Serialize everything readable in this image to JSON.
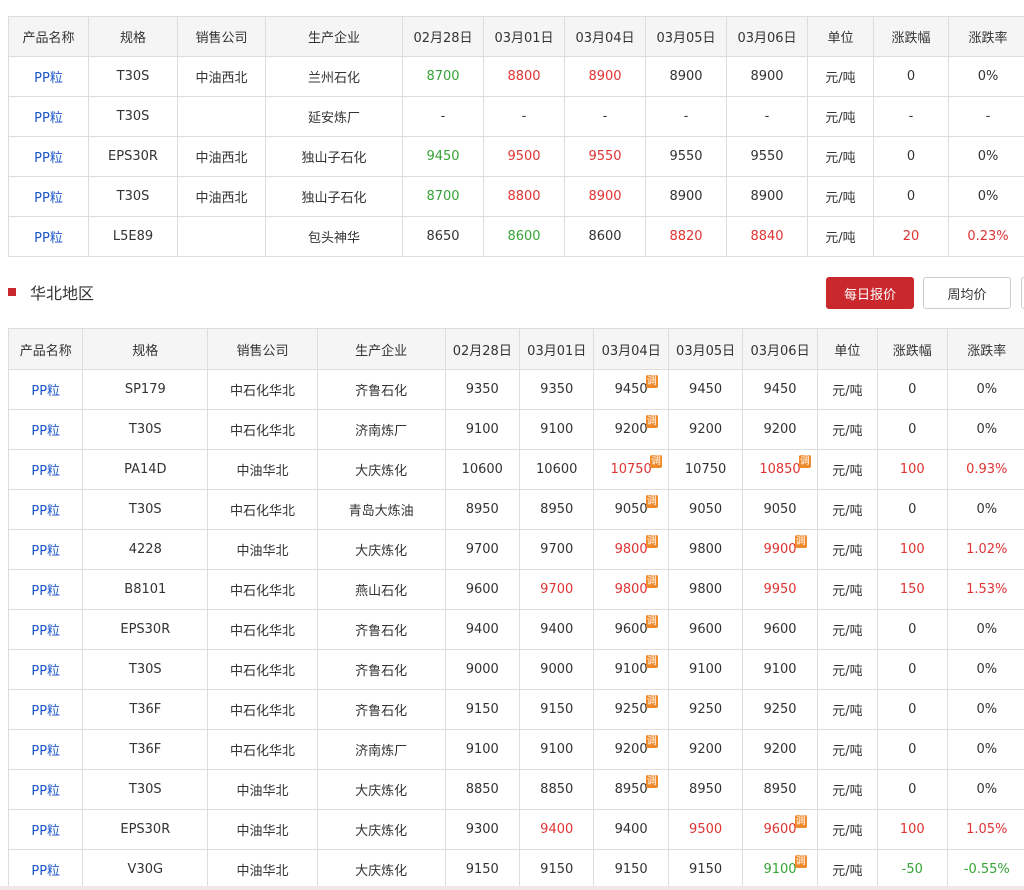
{
  "northwest": {
    "headers": [
      "产品名称",
      "规格",
      "销售公司",
      "生产企业",
      "02月28日",
      "03月01日",
      "03月04日",
      "03月05日",
      "03月06日",
      "单位",
      "涨跌幅",
      "涨跌率"
    ],
    "rows": [
      {
        "product": "PP粒",
        "spec": "T30S",
        "company": "中油西北",
        "producer": "兰州石化",
        "prices": [
          {
            "v": "8700",
            "c": "down"
          },
          {
            "v": "8800",
            "c": "up"
          },
          {
            "v": "8900",
            "c": "up"
          },
          {
            "v": "8900",
            "c": "flat"
          },
          {
            "v": "8900",
            "c": "flat"
          }
        ],
        "unit": "元/吨",
        "change": {
          "v": "0",
          "c": "flat"
        },
        "rate": {
          "v": "0%",
          "c": "flat"
        }
      },
      {
        "product": "PP粒",
        "spec": "T30S",
        "company": "",
        "producer": "延安炼厂",
        "prices": [
          {
            "v": "-",
            "c": "flat"
          },
          {
            "v": "-",
            "c": "flat"
          },
          {
            "v": "-",
            "c": "flat"
          },
          {
            "v": "-",
            "c": "flat"
          },
          {
            "v": "-",
            "c": "flat"
          }
        ],
        "unit": "元/吨",
        "change": {
          "v": "-",
          "c": "flat"
        },
        "rate": {
          "v": "-",
          "c": "flat"
        }
      },
      {
        "product": "PP粒",
        "spec": "EPS30R",
        "company": "中油西北",
        "producer": "独山子石化",
        "prices": [
          {
            "v": "9450",
            "c": "down"
          },
          {
            "v": "9500",
            "c": "up"
          },
          {
            "v": "9550",
            "c": "up"
          },
          {
            "v": "9550",
            "c": "flat"
          },
          {
            "v": "9550",
            "c": "flat"
          }
        ],
        "unit": "元/吨",
        "change": {
          "v": "0",
          "c": "flat"
        },
        "rate": {
          "v": "0%",
          "c": "flat"
        }
      },
      {
        "product": "PP粒",
        "spec": "T30S",
        "company": "中油西北",
        "producer": "独山子石化",
        "prices": [
          {
            "v": "8700",
            "c": "down"
          },
          {
            "v": "8800",
            "c": "up"
          },
          {
            "v": "8900",
            "c": "up"
          },
          {
            "v": "8900",
            "c": "flat"
          },
          {
            "v": "8900",
            "c": "flat"
          }
        ],
        "unit": "元/吨",
        "change": {
          "v": "0",
          "c": "flat"
        },
        "rate": {
          "v": "0%",
          "c": "flat"
        }
      },
      {
        "product": "PP粒",
        "spec": "L5E89",
        "company": "",
        "producer": "包头神华",
        "prices": [
          {
            "v": "8650",
            "c": "flat"
          },
          {
            "v": "8600",
            "c": "down"
          },
          {
            "v": "8600",
            "c": "flat"
          },
          {
            "v": "8820",
            "c": "up"
          },
          {
            "v": "8840",
            "c": "up"
          }
        ],
        "unit": "元/吨",
        "change": {
          "v": "20",
          "c": "up"
        },
        "rate": {
          "v": "0.23%",
          "c": "up"
        }
      }
    ]
  },
  "north_china": {
    "title": "华北地区",
    "buttons": {
      "daily": "每日报价",
      "weekly": "周均价"
    },
    "adjust_mark": "调",
    "headers": [
      "产品名称",
      "规格",
      "销售公司",
      "生产企业",
      "02月28日",
      "03月01日",
      "03月04日",
      "03月05日",
      "03月06日",
      "单位",
      "涨跌幅",
      "涨跌率"
    ],
    "rows": [
      {
        "product": "PP粒",
        "spec": "SP179",
        "company": "中石化华北",
        "producer": "齐鲁石化",
        "prices": [
          {
            "v": "9350",
            "c": "flat"
          },
          {
            "v": "9350",
            "c": "flat"
          },
          {
            "v": "9450",
            "c": "flat",
            "adj": true
          },
          {
            "v": "9450",
            "c": "flat"
          },
          {
            "v": "9450",
            "c": "flat"
          }
        ],
        "unit": "元/吨",
        "change": {
          "v": "0",
          "c": "flat"
        },
        "rate": {
          "v": "0%",
          "c": "flat"
        }
      },
      {
        "product": "PP粒",
        "spec": "T30S",
        "company": "中石化华北",
        "producer": "济南炼厂",
        "prices": [
          {
            "v": "9100",
            "c": "flat"
          },
          {
            "v": "9100",
            "c": "flat"
          },
          {
            "v": "9200",
            "c": "flat",
            "adj": true
          },
          {
            "v": "9200",
            "c": "flat"
          },
          {
            "v": "9200",
            "c": "flat"
          }
        ],
        "unit": "元/吨",
        "change": {
          "v": "0",
          "c": "flat"
        },
        "rate": {
          "v": "0%",
          "c": "flat"
        }
      },
      {
        "product": "PP粒",
        "spec": "PA14D",
        "company": "中油华北",
        "producer": "大庆炼化",
        "prices": [
          {
            "v": "10600",
            "c": "flat"
          },
          {
            "v": "10600",
            "c": "flat"
          },
          {
            "v": "10750",
            "c": "up",
            "adj": true
          },
          {
            "v": "10750",
            "c": "flat"
          },
          {
            "v": "10850",
            "c": "up",
            "adj": true
          }
        ],
        "unit": "元/吨",
        "change": {
          "v": "100",
          "c": "up"
        },
        "rate": {
          "v": "0.93%",
          "c": "up"
        }
      },
      {
        "product": "PP粒",
        "spec": "T30S",
        "company": "中石化华北",
        "producer": "青岛大炼油",
        "prices": [
          {
            "v": "8950",
            "c": "flat"
          },
          {
            "v": "8950",
            "c": "flat"
          },
          {
            "v": "9050",
            "c": "flat",
            "adj": true
          },
          {
            "v": "9050",
            "c": "flat"
          },
          {
            "v": "9050",
            "c": "flat"
          }
        ],
        "unit": "元/吨",
        "change": {
          "v": "0",
          "c": "flat"
        },
        "rate": {
          "v": "0%",
          "c": "flat"
        }
      },
      {
        "product": "PP粒",
        "spec": "4228",
        "company": "中油华北",
        "producer": "大庆炼化",
        "prices": [
          {
            "v": "9700",
            "c": "flat"
          },
          {
            "v": "9700",
            "c": "flat"
          },
          {
            "v": "9800",
            "c": "up",
            "adj": true
          },
          {
            "v": "9800",
            "c": "flat"
          },
          {
            "v": "9900",
            "c": "up",
            "adj": true
          }
        ],
        "unit": "元/吨",
        "change": {
          "v": "100",
          "c": "up"
        },
        "rate": {
          "v": "1.02%",
          "c": "up"
        }
      },
      {
        "product": "PP粒",
        "spec": "B8101",
        "company": "中石化华北",
        "producer": "燕山石化",
        "prices": [
          {
            "v": "9600",
            "c": "flat"
          },
          {
            "v": "9700",
            "c": "up"
          },
          {
            "v": "9800",
            "c": "up",
            "adj": true
          },
          {
            "v": "9800",
            "c": "flat"
          },
          {
            "v": "9950",
            "c": "up"
          }
        ],
        "unit": "元/吨",
        "change": {
          "v": "150",
          "c": "up"
        },
        "rate": {
          "v": "1.53%",
          "c": "up"
        }
      },
      {
        "product": "PP粒",
        "spec": "EPS30R",
        "company": "中石化华北",
        "producer": "齐鲁石化",
        "prices": [
          {
            "v": "9400",
            "c": "flat"
          },
          {
            "v": "9400",
            "c": "flat"
          },
          {
            "v": "9600",
            "c": "flat",
            "adj": true
          },
          {
            "v": "9600",
            "c": "flat"
          },
          {
            "v": "9600",
            "c": "flat"
          }
        ],
        "unit": "元/吨",
        "change": {
          "v": "0",
          "c": "flat"
        },
        "rate": {
          "v": "0%",
          "c": "flat"
        }
      },
      {
        "product": "PP粒",
        "spec": "T30S",
        "company": "中石化华北",
        "producer": "齐鲁石化",
        "prices": [
          {
            "v": "9000",
            "c": "flat"
          },
          {
            "v": "9000",
            "c": "flat"
          },
          {
            "v": "9100",
            "c": "flat",
            "adj": true
          },
          {
            "v": "9100",
            "c": "flat"
          },
          {
            "v": "9100",
            "c": "flat"
          }
        ],
        "unit": "元/吨",
        "change": {
          "v": "0",
          "c": "flat"
        },
        "rate": {
          "v": "0%",
          "c": "flat"
        }
      },
      {
        "product": "PP粒",
        "spec": "T36F",
        "company": "中石化华北",
        "producer": "齐鲁石化",
        "prices": [
          {
            "v": "9150",
            "c": "flat"
          },
          {
            "v": "9150",
            "c": "flat"
          },
          {
            "v": "9250",
            "c": "flat",
            "adj": true
          },
          {
            "v": "9250",
            "c": "flat"
          },
          {
            "v": "9250",
            "c": "flat"
          }
        ],
        "unit": "元/吨",
        "change": {
          "v": "0",
          "c": "flat"
        },
        "rate": {
          "v": "0%",
          "c": "flat"
        }
      },
      {
        "product": "PP粒",
        "spec": "T36F",
        "company": "中石化华北",
        "producer": "济南炼厂",
        "prices": [
          {
            "v": "9100",
            "c": "flat"
          },
          {
            "v": "9100",
            "c": "flat"
          },
          {
            "v": "9200",
            "c": "flat",
            "adj": true
          },
          {
            "v": "9200",
            "c": "flat"
          },
          {
            "v": "9200",
            "c": "flat"
          }
        ],
        "unit": "元/吨",
        "change": {
          "v": "0",
          "c": "flat"
        },
        "rate": {
          "v": "0%",
          "c": "flat"
        }
      },
      {
        "product": "PP粒",
        "spec": "T30S",
        "company": "中油华北",
        "producer": "大庆炼化",
        "prices": [
          {
            "v": "8850",
            "c": "flat"
          },
          {
            "v": "8850",
            "c": "flat"
          },
          {
            "v": "8950",
            "c": "flat",
            "adj": true
          },
          {
            "v": "8950",
            "c": "flat"
          },
          {
            "v": "8950",
            "c": "flat"
          }
        ],
        "unit": "元/吨",
        "change": {
          "v": "0",
          "c": "flat"
        },
        "rate": {
          "v": "0%",
          "c": "flat"
        }
      },
      {
        "product": "PP粒",
        "spec": "EPS30R",
        "company": "中油华北",
        "producer": "大庆炼化",
        "prices": [
          {
            "v": "9300",
            "c": "flat"
          },
          {
            "v": "9400",
            "c": "up"
          },
          {
            "v": "9400",
            "c": "flat"
          },
          {
            "v": "9500",
            "c": "up"
          },
          {
            "v": "9600",
            "c": "up",
            "adj": true
          }
        ],
        "unit": "元/吨",
        "change": {
          "v": "100",
          "c": "up"
        },
        "rate": {
          "v": "1.05%",
          "c": "up"
        }
      },
      {
        "product": "PP粒",
        "spec": "V30G",
        "company": "中油华北",
        "producer": "大庆炼化",
        "prices": [
          {
            "v": "9150",
            "c": "flat"
          },
          {
            "v": "9150",
            "c": "flat"
          },
          {
            "v": "9150",
            "c": "flat"
          },
          {
            "v": "9150",
            "c": "flat"
          },
          {
            "v": "9100",
            "c": "down",
            "adj": true
          }
        ],
        "unit": "元/吨",
        "change": {
          "v": "-50",
          "c": "down"
        },
        "rate": {
          "v": "-0.55%",
          "c": "down"
        }
      }
    ]
  },
  "colors": {
    "up": "#e03434",
    "down": "#36a436",
    "link": "#1b55c8",
    "accent": "#c9282d",
    "adjust_badge": "#f0892a"
  }
}
